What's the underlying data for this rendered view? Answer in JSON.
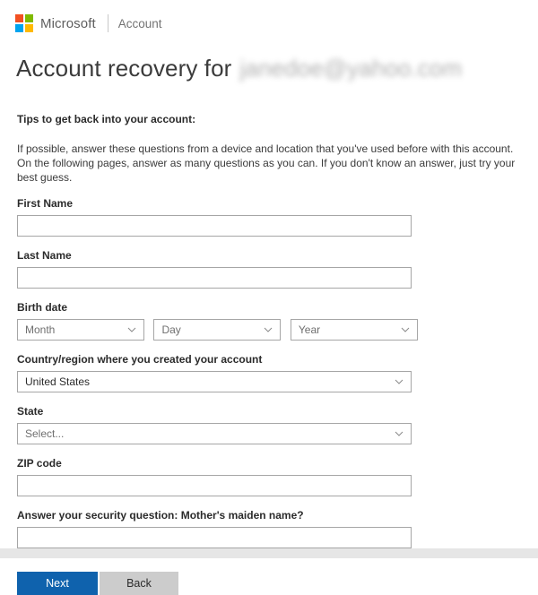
{
  "header": {
    "brand": "Microsoft",
    "product": "Account",
    "logo_icon": "microsoft-logo-icon",
    "logo_colors": {
      "top_left": "#f25022",
      "top_right": "#7fba00",
      "bottom_left": "#00a4ef",
      "bottom_right": "#ffb900"
    }
  },
  "title": {
    "prefix": "Account recovery for",
    "email": "janedoe@yahoo.com"
  },
  "intro": {
    "heading": "Tips to get back into your account:",
    "line1": "If possible, answer these questions from a device and location that you've used before with this account.",
    "line2": "On the following pages, answer as many questions as you can. If you don't know an answer, just try your best guess."
  },
  "form": {
    "first_name": {
      "label": "First Name",
      "value": "",
      "placeholder": ""
    },
    "last_name": {
      "label": "Last Name",
      "value": "",
      "placeholder": ""
    },
    "birth_date": {
      "label": "Birth date",
      "month": {
        "value": "Month",
        "is_placeholder": true
      },
      "day": {
        "value": "Day",
        "is_placeholder": true
      },
      "year": {
        "value": "Year",
        "is_placeholder": true
      }
    },
    "country": {
      "label": "Country/region where you created your account",
      "value": "United States",
      "is_placeholder": false
    },
    "state": {
      "label": "State",
      "value": "Select...",
      "is_placeholder": true
    },
    "zip": {
      "label": "ZIP code",
      "value": "",
      "placeholder": ""
    },
    "security_question": {
      "label": "Answer your security question: Mother's maiden name?",
      "value": "",
      "placeholder": ""
    }
  },
  "buttons": {
    "next": "Next",
    "back": "Back",
    "next_color": "#0f62ad",
    "next_text_color": "#ffffff",
    "back_color": "#cccccc"
  }
}
